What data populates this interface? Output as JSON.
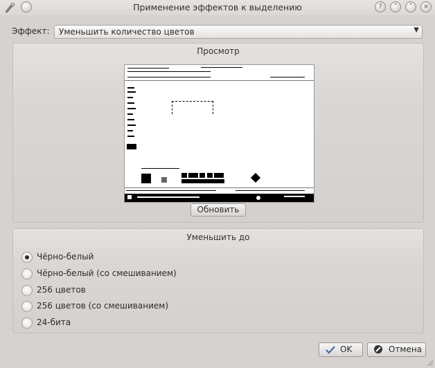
{
  "window": {
    "title": "Применение эффектов к выделению",
    "controls": {
      "help": "?",
      "minimize": "˅",
      "maximize": "˄",
      "close": "×"
    }
  },
  "effect": {
    "label": "Эффект:",
    "selected": "Уменьшить количество цветов"
  },
  "preview": {
    "title": "Просмотр",
    "update_button": "Обновить"
  },
  "reduce": {
    "title": "Уменьшить до",
    "options": [
      {
        "label": "Чёрно-белый",
        "checked": true
      },
      {
        "label": "Чёрно-белый (со смешиванием)",
        "checked": false
      },
      {
        "label": "256 цветов",
        "checked": false
      },
      {
        "label": "256 цветов (со смешиванием)",
        "checked": false
      },
      {
        "label": "24-бита",
        "checked": false
      }
    ]
  },
  "buttons": {
    "ok": "OK",
    "cancel": "Отмена"
  },
  "icons": {
    "app": "kolourpaint-brush-icon",
    "ok": "checkmark-icon",
    "cancel": "cancel-icon"
  }
}
